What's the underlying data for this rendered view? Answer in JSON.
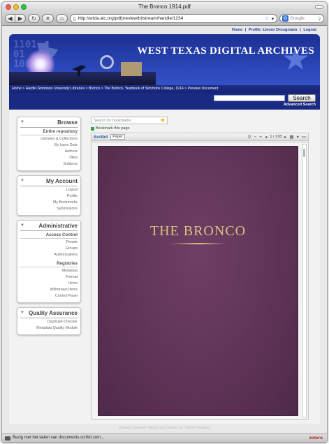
{
  "window": {
    "title": "The Bronco 1914.pdf"
  },
  "browser": {
    "url": "http://wtda.alc.org/pdfpreview/bitstream/handle/1234",
    "search_placeholder": "Google",
    "back_icon": "back-arrow-icon",
    "forward_icon": "forward-arrow-icon"
  },
  "topnav": {
    "home": "Home",
    "profile": "Profile: Lieven Droogmans",
    "logout": "Logout",
    "sep": "|"
  },
  "banner": {
    "title": "WEST TEXAS DIGITAL ARCHIVES",
    "binary": "1101\n01\n100",
    "breadcrumb": "Home > Hardin-Simmons University Libraries > Bronco > The Bronco, Yearbook of Simmons College, 1914 > Preview Document"
  },
  "header_search": {
    "button": "Search",
    "advanced": "Advanced Search"
  },
  "sidebar": {
    "browse": {
      "title": "Browse",
      "section": "Entire repository",
      "items": [
        "Libraries & Collections",
        "By Issue Date",
        "Authors",
        "Titles",
        "Subjects"
      ]
    },
    "account": {
      "title": "My Account",
      "items": [
        "Logout",
        "Profile",
        "My Bookmarks",
        "Submissions"
      ]
    },
    "admin": {
      "title": "Administrative",
      "access_section": "Access Control",
      "access_items": [
        "People",
        "Groups",
        "Authorizations"
      ],
      "registries_section": "Registries",
      "registries_items": [
        "Metadata",
        "Format",
        "Items",
        "Withdrawn Items",
        "Control Panel"
      ]
    },
    "qa": {
      "title": "Quality Assurance",
      "items": [
        "Duplicate Checker",
        "Metadata Quality Module"
      ]
    }
  },
  "viewer": {
    "bookmark_placeholder": "Search for bookmarks",
    "bookmark_link": "Bookmark this page",
    "scribd_label": "Scribd",
    "view_mode": "Paper",
    "page_indicator": "1 / 178",
    "page_title_text": "THE BRONCO"
  },
  "footer": {
    "text": "DSpace Software | About Us | Contact Us | Send Feedback"
  },
  "status": {
    "text": "Bezig met het laden van documents.scribd.com...",
    "zotero": "zotero"
  }
}
